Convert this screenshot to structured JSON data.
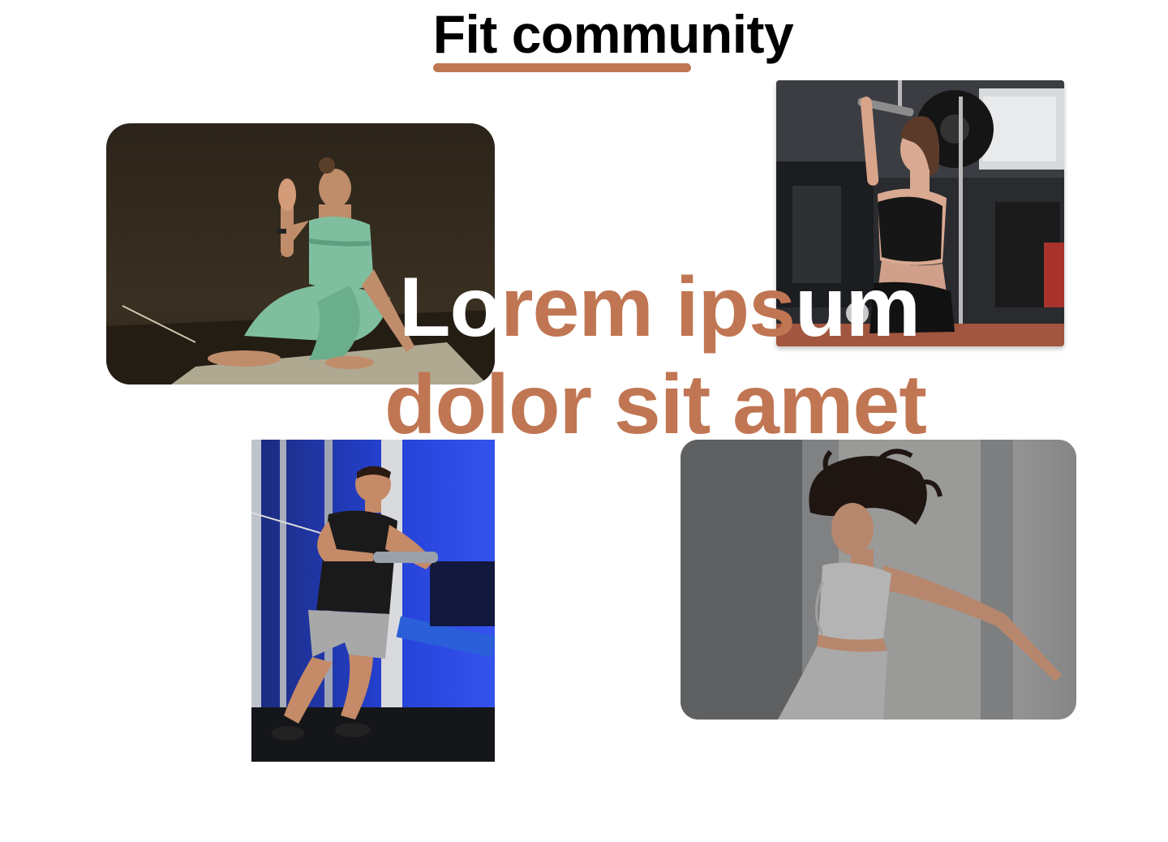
{
  "section": {
    "title": "Fit community"
  },
  "hero": {
    "line1_a": "Lo",
    "line1_b": "rem ips",
    "line1_c": "um",
    "line2": "dolor sit amet"
  },
  "colors": {
    "accent": "#c17653",
    "title": "#000000",
    "background": "#ffffff",
    "overlay_text": "#ffffff"
  },
  "photos": [
    {
      "name": "yoga-woman-photo"
    },
    {
      "name": "gym-woman-pulldown-photo"
    },
    {
      "name": "gym-man-cable-photo"
    },
    {
      "name": "dancing-woman-photo"
    }
  ]
}
